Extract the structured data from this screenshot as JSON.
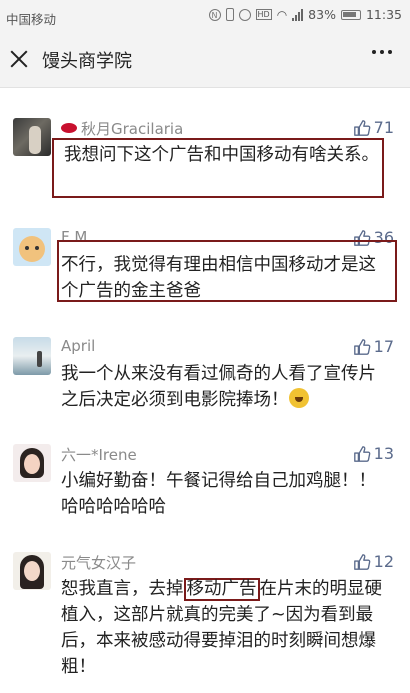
{
  "statusbar": {
    "carrier": "中国移动",
    "battery": "83%",
    "time": "11:35"
  },
  "navbar": {
    "title": "馒头商学院"
  },
  "comments": [
    {
      "name": "秋月Gracilaria",
      "likes": "71",
      "text": "我想问下这个广告和中国移动有啥关系。"
    },
    {
      "name": "F M",
      "likes": "36",
      "text": "不行，我觉得有理由相信中国移动才是这个广告的金主爸爸"
    },
    {
      "name": "April",
      "likes": "17",
      "text": "我一个从来没有看过佩奇的人看了宣传片之后决定必须到电影院捧场！"
    },
    {
      "name": "六一*Irene",
      "likes": "13",
      "text": "小编好勤奋！午餐记得给自己加鸡腿！！哈哈哈哈哈哈"
    },
    {
      "name": "元气女汉子",
      "likes": "12",
      "text_before": "恕我直言，去掉",
      "text_highlight": "移动广告",
      "text_after": "在片末的明显硬植入，这部片就真的完美了~因为看到最后，本来被感动得要掉泪的时刻瞬间想爆粗！"
    }
  ],
  "colors": {
    "highlight_border": "#7a1a1a",
    "like_color": "#5b6b8c",
    "name_color": "#8a8a8a"
  },
  "icons": [
    "close-icon",
    "more-icon",
    "thumbs-up-icon",
    "lips-icon",
    "sad-emoji-icon"
  ]
}
